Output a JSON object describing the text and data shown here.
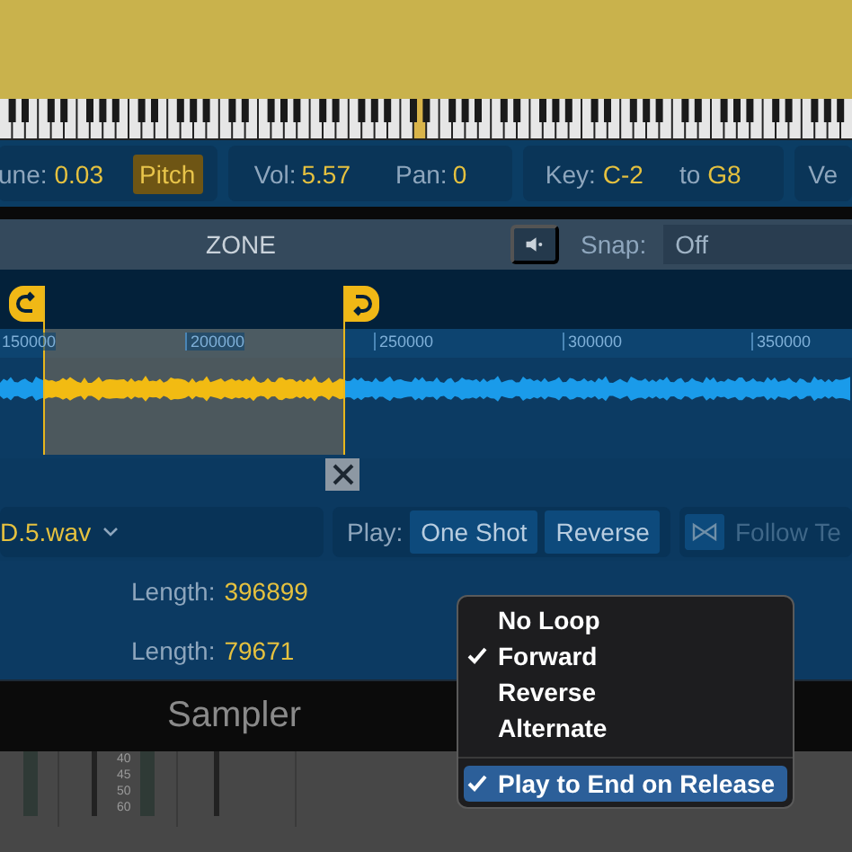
{
  "param_groups": [
    {
      "items": [
        {
          "kind": "value",
          "label": "une:",
          "value": "0.03"
        },
        {
          "kind": "toggle",
          "label": "Pitch",
          "on": true
        }
      ]
    },
    {
      "items": [
        {
          "kind": "value",
          "label": "Vol:",
          "value": "5.57"
        },
        {
          "kind": "value",
          "label": "Pan:",
          "value": "0"
        }
      ]
    },
    {
      "items": [
        {
          "kind": "value",
          "label": "Key:",
          "value": "C-2"
        },
        {
          "kind": "value",
          "label": "to",
          "value": "G8"
        }
      ]
    },
    {
      "items": [
        {
          "kind": "label",
          "label": "Ve"
        }
      ]
    }
  ],
  "zone": {
    "title": "ZONE",
    "snap_label": "Snap:",
    "snap_value": "Off",
    "ruler": [
      "150000",
      "200000",
      "250000",
      "300000",
      "350000"
    ]
  },
  "file_row": {
    "file": "D.5.wav",
    "play_label": "Play:",
    "play_buttons": [
      {
        "label": "One Shot",
        "selected": false
      },
      {
        "label": "Reverse",
        "selected": false
      }
    ],
    "follow": {
      "label": "Follow Te",
      "disabled": true
    }
  },
  "info": {
    "rows": [
      {
        "label": "Length:",
        "value": "396899"
      },
      {
        "label": "Length:",
        "value": "79671"
      }
    ]
  },
  "tab": {
    "title": "Sampler"
  },
  "mixer": {
    "ticks": [
      "40",
      "45",
      "50",
      "60"
    ]
  },
  "loop_menu": {
    "items": [
      {
        "label": "No Loop",
        "checked": false,
        "selected": false
      },
      {
        "label": "Forward",
        "checked": true,
        "selected": false
      },
      {
        "label": "Reverse",
        "checked": false,
        "selected": false
      },
      {
        "label": "Alternate",
        "checked": false,
        "selected": false
      }
    ],
    "release": {
      "label": "Play to End on Release",
      "checked": true,
      "selected": true
    }
  }
}
